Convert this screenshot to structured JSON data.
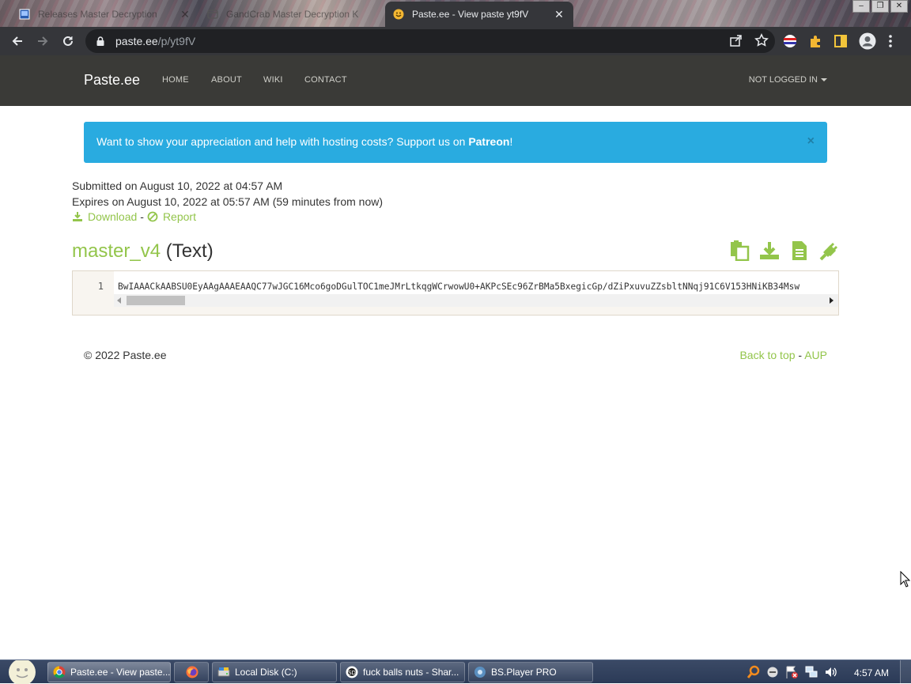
{
  "browser": {
    "tabs": [
      {
        "title": "Releases Master Decryption",
        "icon": "windows-app-icon"
      },
      {
        "title": "GandCrab Master Decryption K",
        "icon": "page-icon"
      },
      {
        "title": "Paste.ee - View paste yt9fV",
        "icon": "pastee-favicon",
        "active": true
      }
    ],
    "url_host": "paste.ee",
    "url_path": "/p/yt9fV"
  },
  "site": {
    "brand": "Paste.ee",
    "nav": [
      "HOME",
      "ABOUT",
      "WIKI",
      "CONTACT"
    ],
    "user_menu": "NOT LOGGED IN"
  },
  "alert": {
    "text": "Want to show your appreciation and help with hosting costs? Support us on ",
    "link": "Patreon",
    "suffix": "!",
    "close": "×"
  },
  "paste": {
    "submitted": "Submitted on August 10, 2022 at 04:57 AM",
    "expires": "Expires on August 10, 2022 at 05:57 AM (59 minutes from now)",
    "download_label": "Download",
    "separator": "-",
    "report_label": "Report",
    "name": "master_v4",
    "type": "(Text)",
    "line_number": "1",
    "content": "BwIAAACkAABSU0EyAAgAAAEAAQC77wJGC16Mco6goDGulTOC1meJMrLtkqgWCrwowU0+AKPcSEc96ZrBMa5BxegicGp/dZiPxuvuZZsbltNNqj91C6V153HNiKB34Msw"
  },
  "footer": {
    "copyright": "© 2022 Paste.ee",
    "back_to_top": "Back to top",
    "separator": "-",
    "aup": "AUP"
  },
  "taskbar": {
    "buttons": [
      {
        "label": "Paste.ee - View paste...",
        "icon": "chrome-icon",
        "active": true
      },
      {
        "label": "",
        "icon": "firefox-icon"
      },
      {
        "label": "Local Disk (C:)",
        "icon": "drive-icon"
      },
      {
        "label": "fuck balls nuts - Shar...",
        "icon": "sharex-icon"
      },
      {
        "label": "BS.Player PRO",
        "icon": "bsplayer-icon"
      }
    ],
    "clock": "4:57 AM"
  },
  "colors": {
    "accent_green": "#93c54b",
    "alert_blue": "#29abe0",
    "navbar": "#3a3a37",
    "browser_toolbar": "#35363a"
  }
}
